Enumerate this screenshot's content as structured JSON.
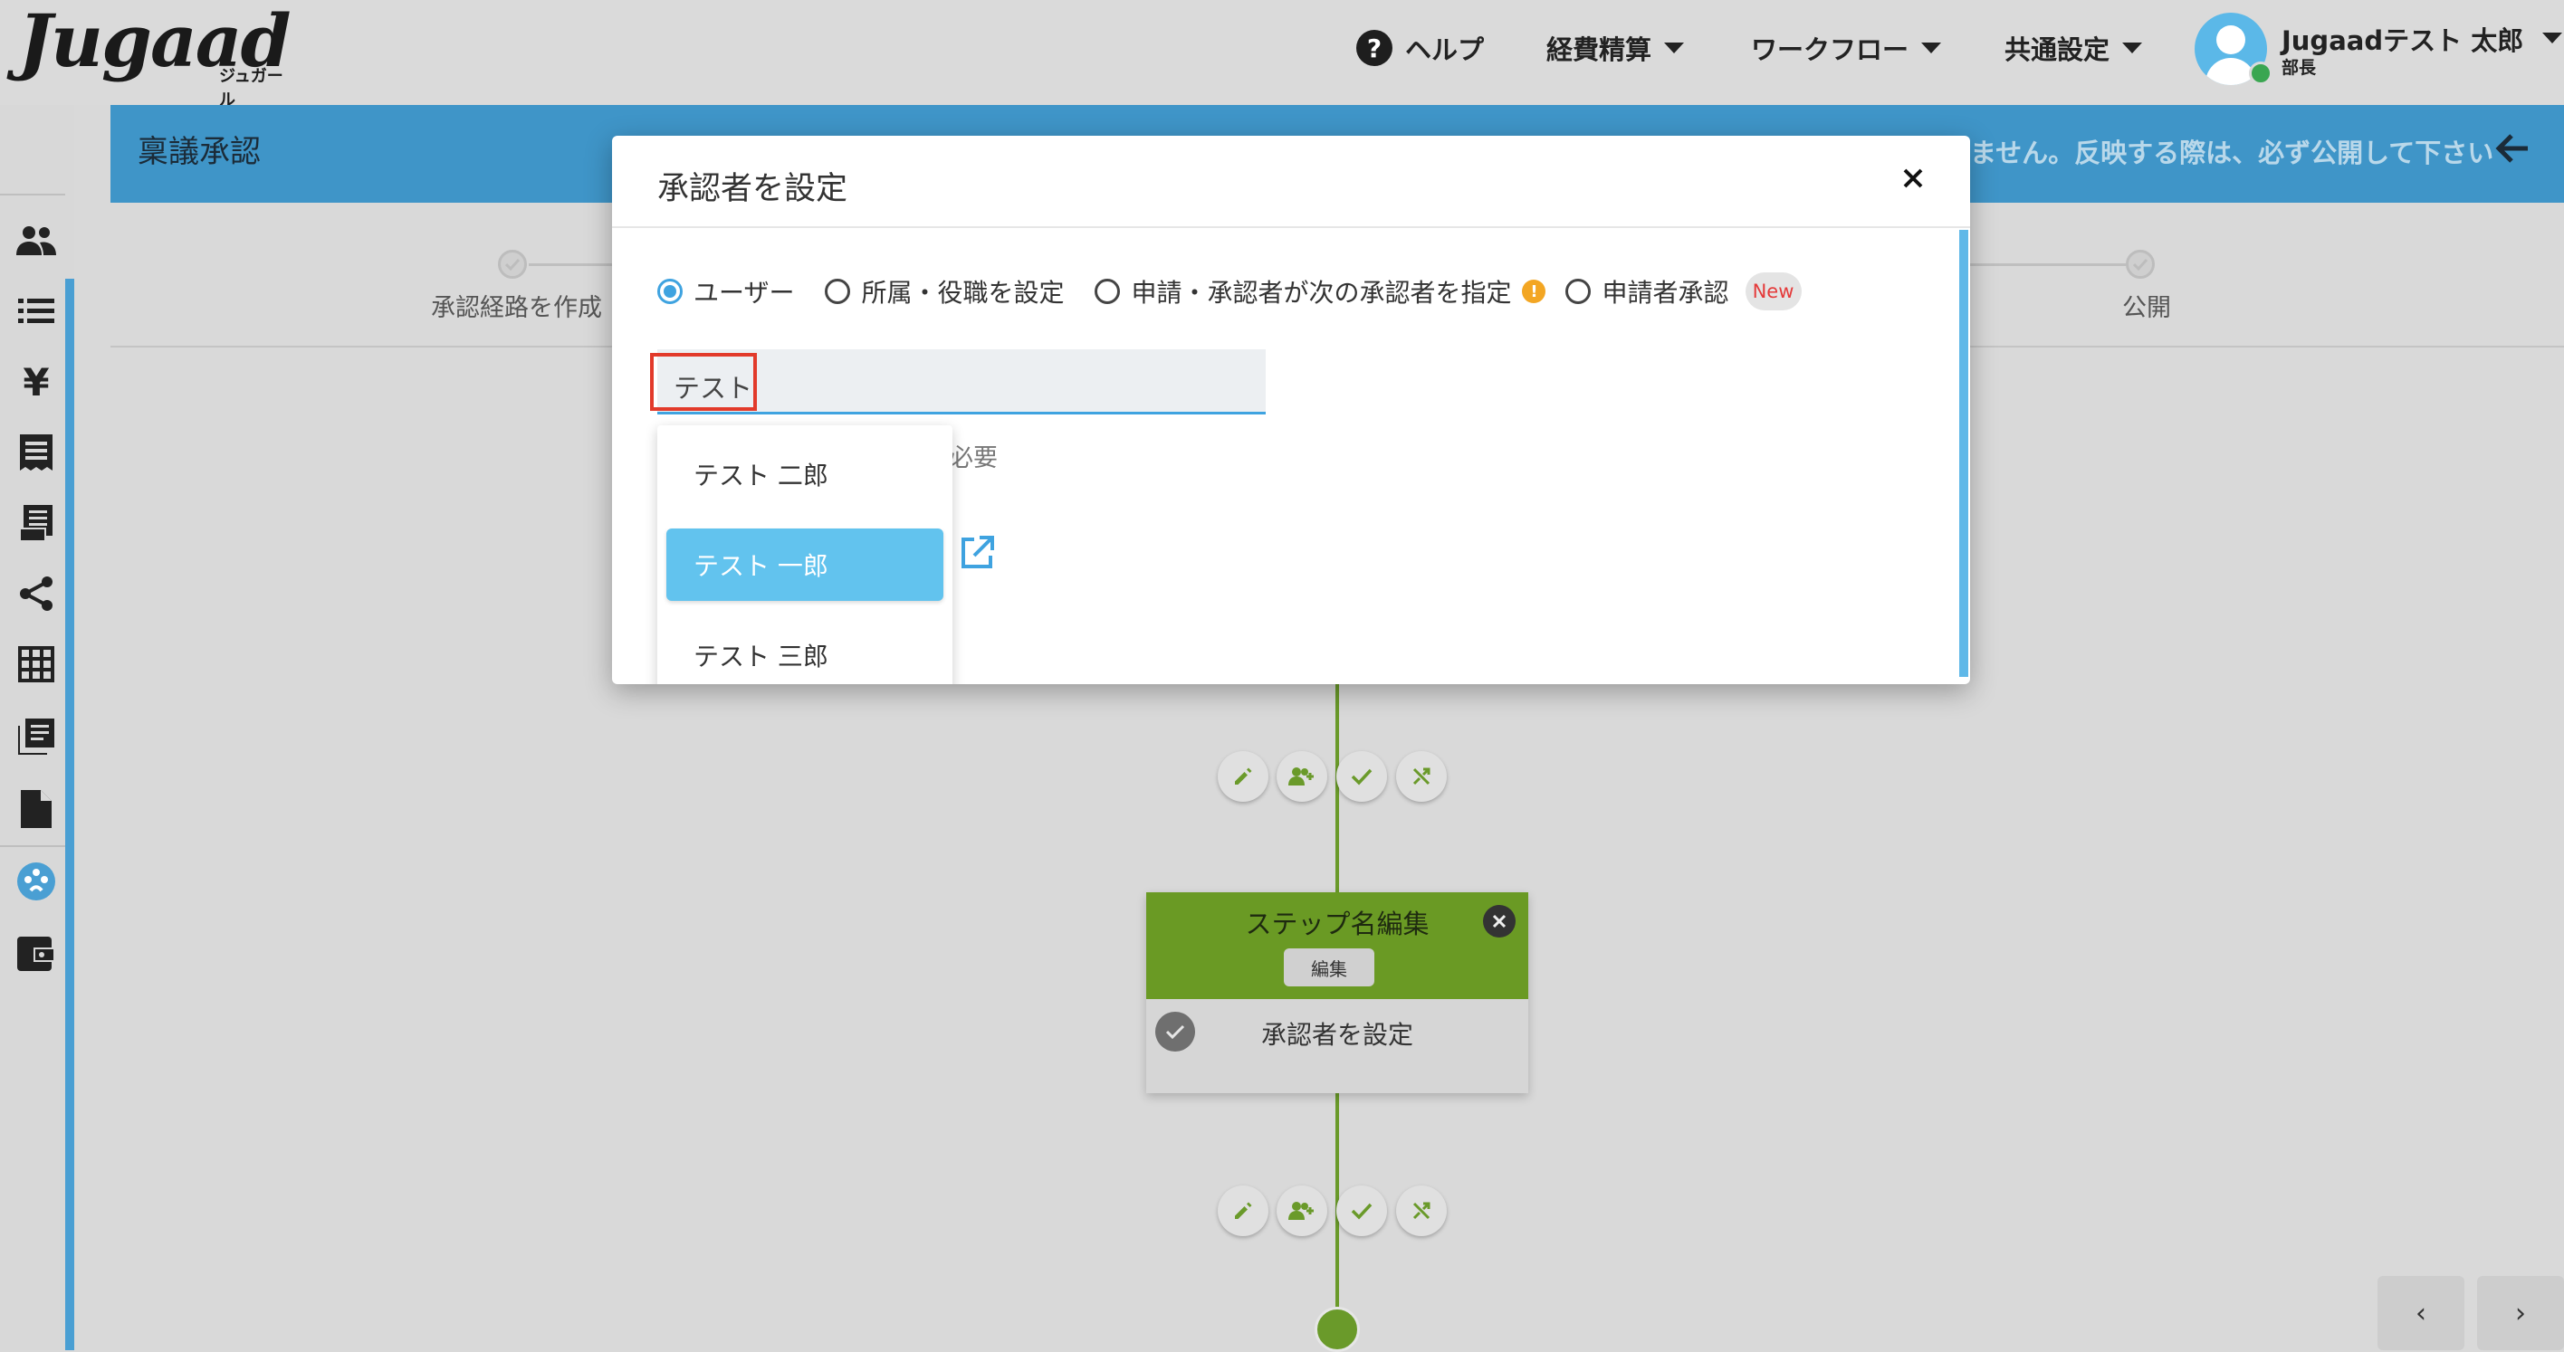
{
  "header": {
    "logo_text": "Jugaad",
    "logo_sub": "ジュガール",
    "help_label": "ヘルプ",
    "nav": {
      "expense": "経費精算",
      "workflow": "ワークフロー",
      "common": "共通設定"
    },
    "user": {
      "name": "Jugaadテスト 太郎",
      "role": "部長"
    }
  },
  "sidebar": {
    "items": [
      "people-icon",
      "list-icon",
      "yen-icon",
      "receipt-icon",
      "document-list-icon",
      "share-icon",
      "grid-icon",
      "library-icon",
      "file-icon",
      "palette-icon",
      "wallet-icon"
    ]
  },
  "page": {
    "title": "稟議承認",
    "notice": "ません。反映する際は、必ず公開して下さい",
    "steps": {
      "create_route": "承認経路を作成",
      "publish": "公開"
    }
  },
  "step_card": {
    "title": "ステップ名編集",
    "edit_label": "編集",
    "approver_label": "承認者を設定"
  },
  "modal": {
    "title": "承認者を設定",
    "radios": [
      {
        "label": "ユーザー",
        "checked": true
      },
      {
        "label": "所属・役職を設定",
        "checked": false
      },
      {
        "label": "申請・承認者が次の承認者を指定",
        "checked": false
      },
      {
        "label": "申請者承認",
        "checked": false
      }
    ],
    "info_glyph": "!",
    "new_badge": "New",
    "search_value": "テスト",
    "background_required": "必要",
    "dropdown": [
      {
        "label": "テスト 二郎",
        "selected": false
      },
      {
        "label": "テスト 一郎",
        "selected": true
      },
      {
        "label": "テスト 三郎",
        "selected": false
      }
    ]
  },
  "pager": {
    "prev": "‹",
    "next": "›"
  },
  "colors": {
    "accent": "#3fa3e0",
    "flow_green": "#6a9a2a",
    "highlight_red": "#e23a2b",
    "selected_bg": "#62c3ee"
  }
}
